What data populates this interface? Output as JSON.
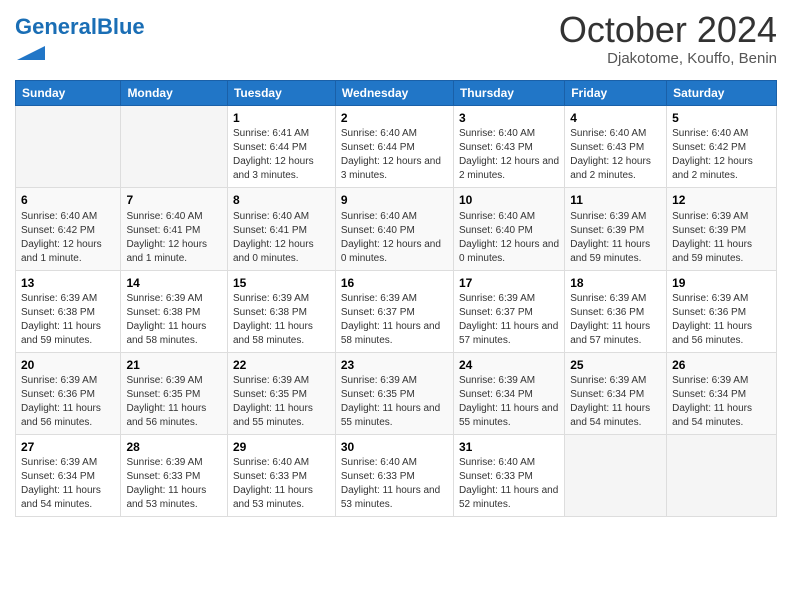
{
  "header": {
    "logo_general": "General",
    "logo_blue": "Blue",
    "month_title": "October 2024",
    "subtitle": "Djakotome, Kouffo, Benin"
  },
  "days_of_week": [
    "Sunday",
    "Monday",
    "Tuesday",
    "Wednesday",
    "Thursday",
    "Friday",
    "Saturday"
  ],
  "weeks": [
    [
      {
        "num": "",
        "info": ""
      },
      {
        "num": "",
        "info": ""
      },
      {
        "num": "1",
        "info": "Sunrise: 6:41 AM\nSunset: 6:44 PM\nDaylight: 12 hours and 3 minutes."
      },
      {
        "num": "2",
        "info": "Sunrise: 6:40 AM\nSunset: 6:44 PM\nDaylight: 12 hours and 3 minutes."
      },
      {
        "num": "3",
        "info": "Sunrise: 6:40 AM\nSunset: 6:43 PM\nDaylight: 12 hours and 2 minutes."
      },
      {
        "num": "4",
        "info": "Sunrise: 6:40 AM\nSunset: 6:43 PM\nDaylight: 12 hours and 2 minutes."
      },
      {
        "num": "5",
        "info": "Sunrise: 6:40 AM\nSunset: 6:42 PM\nDaylight: 12 hours and 2 minutes."
      }
    ],
    [
      {
        "num": "6",
        "info": "Sunrise: 6:40 AM\nSunset: 6:42 PM\nDaylight: 12 hours and 1 minute."
      },
      {
        "num": "7",
        "info": "Sunrise: 6:40 AM\nSunset: 6:41 PM\nDaylight: 12 hours and 1 minute."
      },
      {
        "num": "8",
        "info": "Sunrise: 6:40 AM\nSunset: 6:41 PM\nDaylight: 12 hours and 0 minutes."
      },
      {
        "num": "9",
        "info": "Sunrise: 6:40 AM\nSunset: 6:40 PM\nDaylight: 12 hours and 0 minutes."
      },
      {
        "num": "10",
        "info": "Sunrise: 6:40 AM\nSunset: 6:40 PM\nDaylight: 12 hours and 0 minutes."
      },
      {
        "num": "11",
        "info": "Sunrise: 6:39 AM\nSunset: 6:39 PM\nDaylight: 11 hours and 59 minutes."
      },
      {
        "num": "12",
        "info": "Sunrise: 6:39 AM\nSunset: 6:39 PM\nDaylight: 11 hours and 59 minutes."
      }
    ],
    [
      {
        "num": "13",
        "info": "Sunrise: 6:39 AM\nSunset: 6:38 PM\nDaylight: 11 hours and 59 minutes."
      },
      {
        "num": "14",
        "info": "Sunrise: 6:39 AM\nSunset: 6:38 PM\nDaylight: 11 hours and 58 minutes."
      },
      {
        "num": "15",
        "info": "Sunrise: 6:39 AM\nSunset: 6:38 PM\nDaylight: 11 hours and 58 minutes."
      },
      {
        "num": "16",
        "info": "Sunrise: 6:39 AM\nSunset: 6:37 PM\nDaylight: 11 hours and 58 minutes."
      },
      {
        "num": "17",
        "info": "Sunrise: 6:39 AM\nSunset: 6:37 PM\nDaylight: 11 hours and 57 minutes."
      },
      {
        "num": "18",
        "info": "Sunrise: 6:39 AM\nSunset: 6:36 PM\nDaylight: 11 hours and 57 minutes."
      },
      {
        "num": "19",
        "info": "Sunrise: 6:39 AM\nSunset: 6:36 PM\nDaylight: 11 hours and 56 minutes."
      }
    ],
    [
      {
        "num": "20",
        "info": "Sunrise: 6:39 AM\nSunset: 6:36 PM\nDaylight: 11 hours and 56 minutes."
      },
      {
        "num": "21",
        "info": "Sunrise: 6:39 AM\nSunset: 6:35 PM\nDaylight: 11 hours and 56 minutes."
      },
      {
        "num": "22",
        "info": "Sunrise: 6:39 AM\nSunset: 6:35 PM\nDaylight: 11 hours and 55 minutes."
      },
      {
        "num": "23",
        "info": "Sunrise: 6:39 AM\nSunset: 6:35 PM\nDaylight: 11 hours and 55 minutes."
      },
      {
        "num": "24",
        "info": "Sunrise: 6:39 AM\nSunset: 6:34 PM\nDaylight: 11 hours and 55 minutes."
      },
      {
        "num": "25",
        "info": "Sunrise: 6:39 AM\nSunset: 6:34 PM\nDaylight: 11 hours and 54 minutes."
      },
      {
        "num": "26",
        "info": "Sunrise: 6:39 AM\nSunset: 6:34 PM\nDaylight: 11 hours and 54 minutes."
      }
    ],
    [
      {
        "num": "27",
        "info": "Sunrise: 6:39 AM\nSunset: 6:34 PM\nDaylight: 11 hours and 54 minutes."
      },
      {
        "num": "28",
        "info": "Sunrise: 6:39 AM\nSunset: 6:33 PM\nDaylight: 11 hours and 53 minutes."
      },
      {
        "num": "29",
        "info": "Sunrise: 6:40 AM\nSunset: 6:33 PM\nDaylight: 11 hours and 53 minutes."
      },
      {
        "num": "30",
        "info": "Sunrise: 6:40 AM\nSunset: 6:33 PM\nDaylight: 11 hours and 53 minutes."
      },
      {
        "num": "31",
        "info": "Sunrise: 6:40 AM\nSunset: 6:33 PM\nDaylight: 11 hours and 52 minutes."
      },
      {
        "num": "",
        "info": ""
      },
      {
        "num": "",
        "info": ""
      }
    ]
  ]
}
